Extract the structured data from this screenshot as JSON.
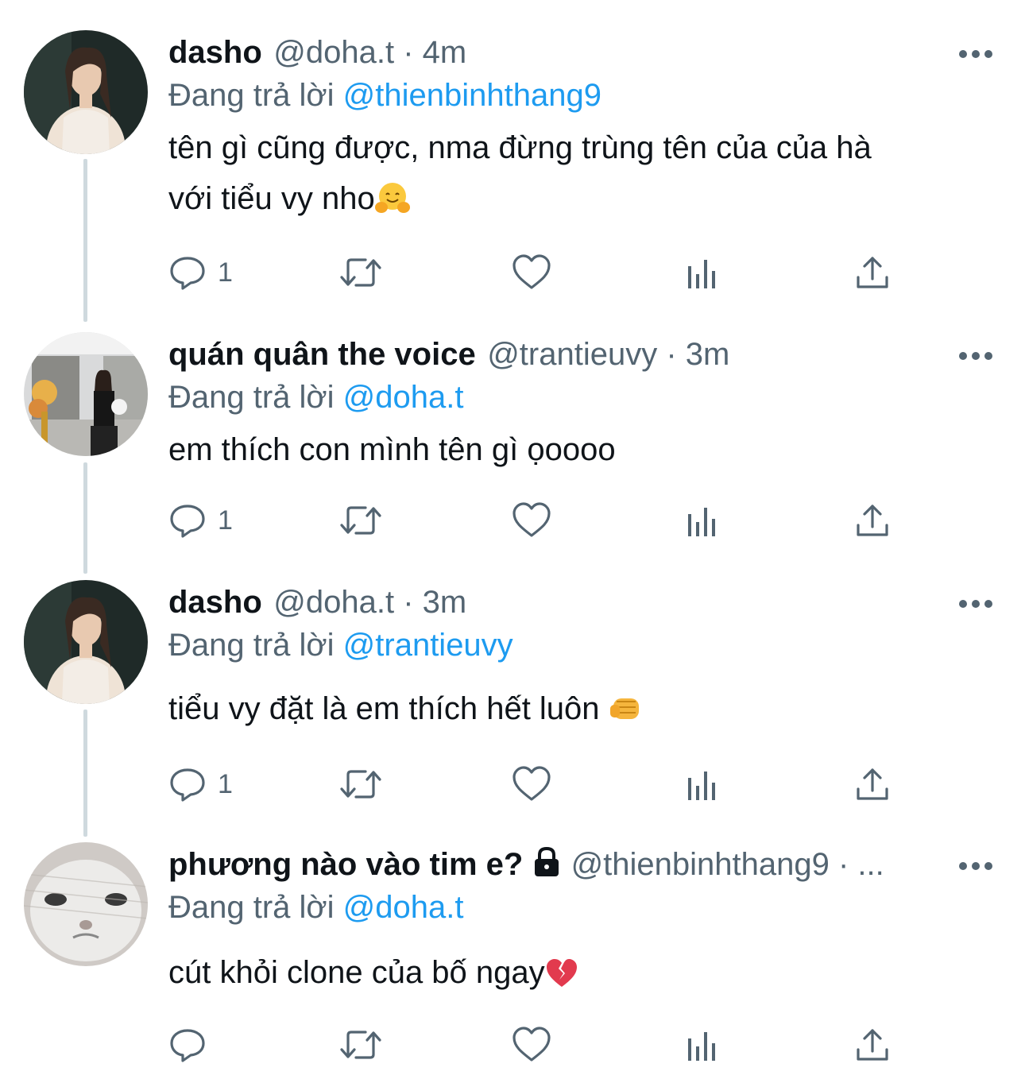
{
  "colors": {
    "link": "#1d9bf0",
    "muted": "#536471",
    "text": "#0f1419",
    "thread_line": "#cfd9de",
    "heart_emoji": "#e23a4e"
  },
  "tweets": [
    {
      "name": "dasho",
      "handle": "@doha.t",
      "sep": " · ",
      "time": "4m",
      "reply_prefix": "Đang trả lời ",
      "reply_to": "@thienbinhthang9",
      "text_line1": "tên gì cũng được, nma đừng trùng  tên của của hà",
      "text_line2": "với tiểu vy nho",
      "emoji": "hugging-face-emoji",
      "reply_count": "1"
    },
    {
      "name": "quán quân the voice",
      "handle": "@trantieuvy",
      "sep": " · ",
      "time": "3m",
      "reply_prefix": "Đang trả lời ",
      "reply_to": "@doha.t",
      "text_line1": "em thích con mình tên gì ọoooo",
      "reply_count": "1"
    },
    {
      "name": "dasho",
      "handle": "@doha.t",
      "sep": " · ",
      "time": "3m",
      "reply_prefix": "Đang trả lời ",
      "reply_to": "@trantieuvy",
      "text_line1": "tiểu vy đặt là em thích hết luôn ",
      "emoji": "fist-emoji",
      "reply_count": "1"
    },
    {
      "name": "phương nào vào tim e?",
      "handle": "@thienbinhthang9",
      "sep": " · ",
      "time": "...",
      "reply_prefix": "Đang trả lời ",
      "reply_to": "@doha.t",
      "text_line1": "cút khỏi clone của bố ngay",
      "emoji": "broken-heart-emoji",
      "reply_count": ""
    }
  ]
}
